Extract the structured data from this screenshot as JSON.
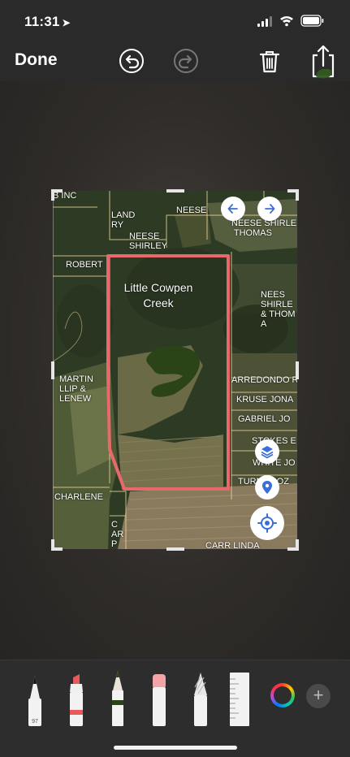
{
  "status_bar": {
    "time": "11:31"
  },
  "toolbar": {
    "done_label": "Done",
    "undo": "undo-icon",
    "redo": "redo-icon",
    "delete": "trash-icon",
    "share": "share-icon"
  },
  "map": {
    "creek_label": "Little Cowpen\nCreek",
    "parcels": [
      {
        "id": "b-inc",
        "text": "B INC"
      },
      {
        "id": "landry",
        "text": "LAND\nRY"
      },
      {
        "id": "neese-top",
        "text": "NEESE"
      },
      {
        "id": "neese-shirley",
        "text": "NEESE\nSHIRLEY"
      },
      {
        "id": "neese-shirl-thomas",
        "text": "NEESE SHIRLE\n THOMAS"
      },
      {
        "id": "robert",
        "text": "ROBERT"
      },
      {
        "id": "neese-shirle-thom",
        "text": "NEES\nSHIRLE\n& THOM\nA"
      },
      {
        "id": "martin",
        "text": "MARTIN\nLLIP &\nLENEW"
      },
      {
        "id": "arredondo",
        "text": "ARREDONDO R"
      },
      {
        "id": "kruse",
        "text": "KRUSE JONA"
      },
      {
        "id": "gabriel",
        "text": "GABRIEL JO"
      },
      {
        "id": "stokes",
        "text": "STOKES E"
      },
      {
        "id": "white",
        "text": "WHITE JO"
      },
      {
        "id": "turner",
        "text": "TURN   ROZ"
      },
      {
        "id": "charlene",
        "text": "CHARLENE"
      },
      {
        "id": "carr-small",
        "text": "C\nAR\nP"
      },
      {
        "id": "carr-linda",
        "text": "CARR LINDA"
      }
    ],
    "boundary_color": "#e8696b"
  },
  "tools": [
    "pen-tool",
    "marker-tool",
    "pencil-tool",
    "eraser-tool",
    "lasso-tool",
    "ruler-tool"
  ],
  "pen_width": "97",
  "colors": {
    "accent": "#3a6fd8"
  }
}
